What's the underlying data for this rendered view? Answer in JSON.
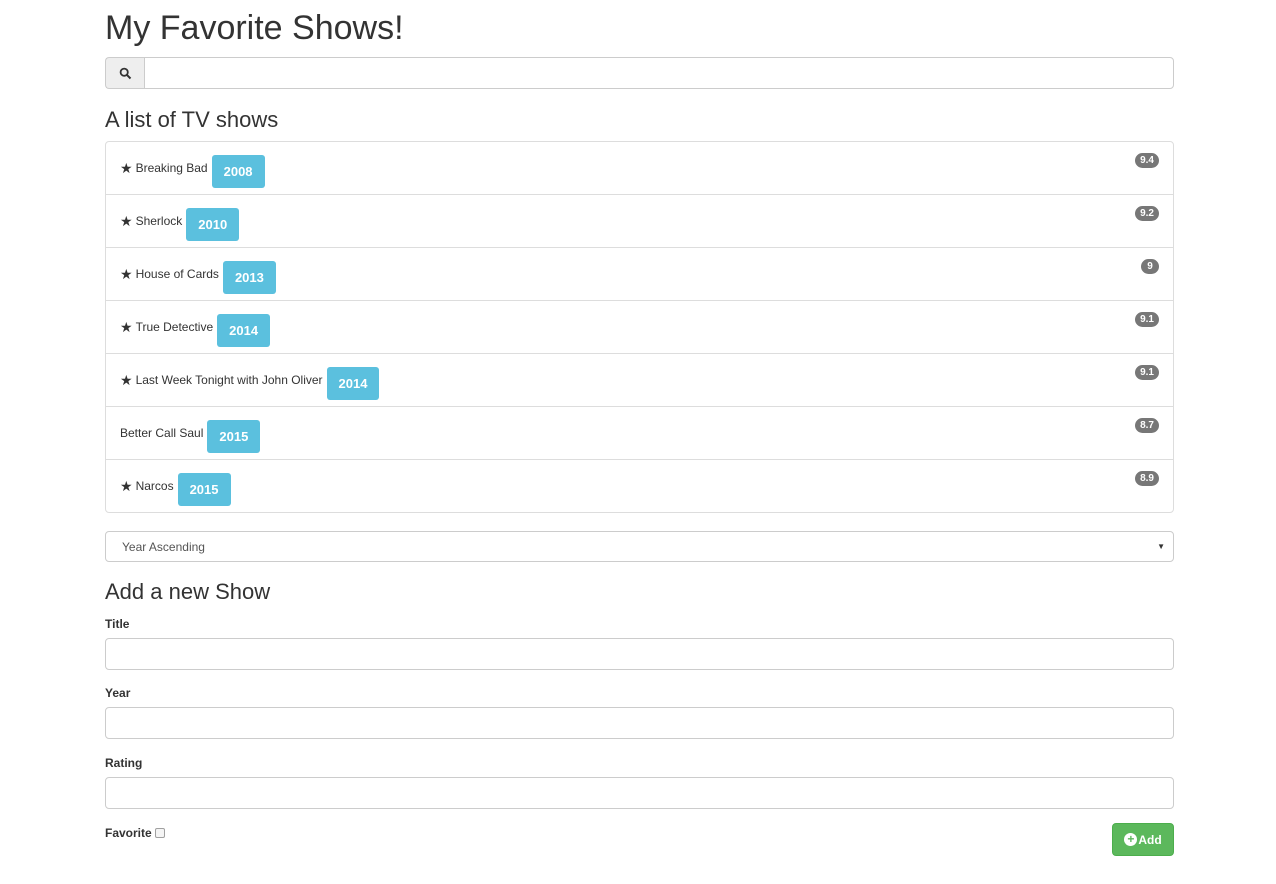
{
  "page": {
    "title": "My Favorite Shows!"
  },
  "search": {
    "value": "",
    "placeholder": ""
  },
  "list_title": "A list of TV shows",
  "shows": [
    {
      "title": "Breaking Bad",
      "year": "2008",
      "rating": "9.4",
      "favorite": true
    },
    {
      "title": "Sherlock",
      "year": "2010",
      "rating": "9.2",
      "favorite": true
    },
    {
      "title": "House of Cards",
      "year": "2013",
      "rating": "9",
      "favorite": true
    },
    {
      "title": "True Detective",
      "year": "2014",
      "rating": "9.1",
      "favorite": true
    },
    {
      "title": "Last Week Tonight with John Oliver",
      "year": "2014",
      "rating": "9.1",
      "favorite": true
    },
    {
      "title": "Better Call Saul",
      "year": "2015",
      "rating": "8.7",
      "favorite": false
    },
    {
      "title": "Narcos",
      "year": "2015",
      "rating": "8.9",
      "favorite": true
    }
  ],
  "sort": {
    "selected": "Year Ascending"
  },
  "form": {
    "heading": "Add a new Show",
    "title_label": "Title",
    "year_label": "Year",
    "rating_label": "Rating",
    "favorite_label": "Favorite",
    "favorite_checked": false,
    "add_label": "Add"
  },
  "icons": {
    "search": "search-icon",
    "star": "star-icon",
    "add": "plus-circle-icon"
  },
  "colors": {
    "year_label": "#5bc0de",
    "rating_badge": "#777777",
    "add_button": "#5cb85c"
  }
}
